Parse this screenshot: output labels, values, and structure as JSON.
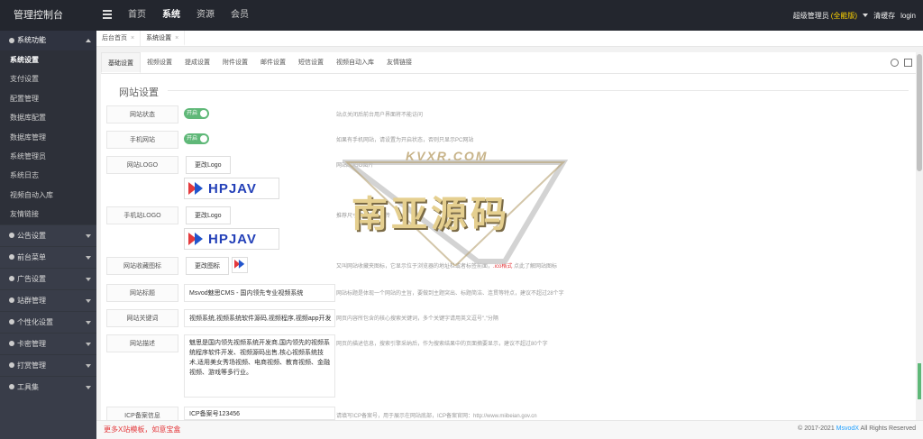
{
  "app": {
    "title": "管理控制台"
  },
  "topnav": {
    "items": [
      "首页",
      "系统",
      "资源",
      "会员"
    ],
    "active": "系统"
  },
  "user": {
    "name": "超级管理员",
    "edition": "(全能版)",
    "clear_cache": "清缓存",
    "logout": "login"
  },
  "sidebar": {
    "section": "系统功能",
    "items": [
      "系统设置",
      "支付设置",
      "配置管理",
      "数据库配置",
      "数据库管理",
      "系统管理员",
      "系统日志",
      "视频自动入库",
      "友情链接"
    ],
    "active": "系统设置",
    "groups": [
      "公告设置",
      "前台菜单",
      "广告设置",
      "站群管理",
      "个性化设置",
      "卡密管理",
      "打赏管理",
      "工具集"
    ]
  },
  "tabs": [
    {
      "label": "后台首页"
    },
    {
      "label": "系统设置"
    }
  ],
  "subtabs": [
    "基础设置",
    "视频设置",
    "提成设置",
    "附件设置",
    "邮件设置",
    "短信设置",
    "视频自动入库",
    "友情链接"
  ],
  "form": {
    "section_title": "网站设置",
    "site_status": {
      "label": "网站状态",
      "toggle": "开启",
      "hint": "站点关闭后前台用户界面将不能访问"
    },
    "mobile_site": {
      "label": "手机网站",
      "toggle": "开启",
      "hint": "如果有手机网站，请设置为开启状态，否则只显示PC网站"
    },
    "site_logo": {
      "label": "网站LOGO",
      "button": "更改Logo",
      "hint": "网站LOGO图片",
      "logo_text": "HPJAV"
    },
    "mobile_logo": {
      "label": "手机站LOGO",
      "button": "更改Logo",
      "hint": "推荐尺寸可以自由上传",
      "logo_text": "HPJAV"
    },
    "favicon": {
      "label": "网站收藏图标",
      "button": "更改图标",
      "hint": "又叫网站收藏夹图标，它显示位于浏览器的地址栏或者标签前面，",
      "hint_red": ".ico格式",
      "hint_tail": "点此了解网站图标"
    },
    "site_title": {
      "label": "网站标题",
      "value": "Msvod魅思CMS - 国内领先专业视频系统",
      "hint": "网站标题是体现一个网站的主旨，要做到主题突出、标题简洁、连贯等特点，建议不超过28个字"
    },
    "keywords": {
      "label": "网站关键词",
      "value": "视频系统,视频系统软件源码,视频程序,视频app开发",
      "hint": "网页内容所包含的核心搜索关键词，多个关键字请用英文逗号\",\"分隔"
    },
    "description": {
      "label": "网站描述",
      "value": "魅思是国内领先视频系统开发商,国内领先的视频系统程序软件开发、视频源码出售,核心视频系统技术,适用美女秀场视频、电商视频、教育视频、金融视频、游戏等多行业。",
      "hint": "网页的描述信息，搜索引擎采纳后，作为搜索结果中的页面摘要显示，建议不超过80个字"
    },
    "icp": {
      "label": "ICP备案信息",
      "value": "ICP备案号123456",
      "hint": "请填写ICP备案号，用于展示在网站底部，ICP备案官网：http://www.miibeian.gov.cn"
    }
  },
  "watermark": {
    "top": "KVXR.COM",
    "main": "南亚源码"
  },
  "footer": {
    "promo": "更多X站模板，如意宝盒",
    "copy": "© 2017-2021",
    "brand": "MsvodX",
    "rights": "All Rights Reserved"
  },
  "colors": {
    "topbar": "#23262e",
    "sidebar": "#393d49",
    "toggle_on": "#5fb878",
    "accent_red": "#e4393c"
  }
}
